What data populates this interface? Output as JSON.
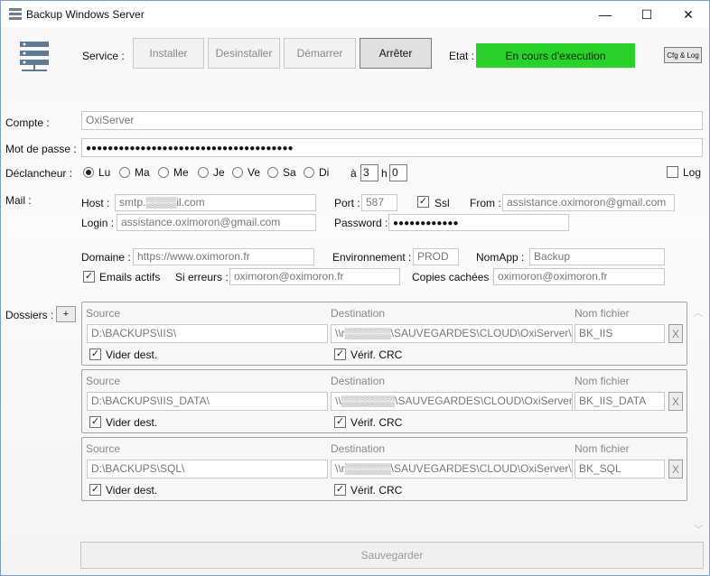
{
  "window": {
    "title": "Backup Windows Server",
    "minimize": "—",
    "maximize": "☐",
    "close": "✕"
  },
  "service": {
    "label": "Service :",
    "install": "Installer",
    "uninstall": "Desinstaller",
    "start": "Démarrer",
    "stop": "Arrêter",
    "state_label": "Etat :",
    "state_value": "En cours d'execution",
    "state_color": "#2ad12a",
    "cfg_log": "Cfg & Log"
  },
  "account": {
    "label": "Compte :",
    "value": "OxiServer"
  },
  "password": {
    "label": "Mot de passe :",
    "value": "●●●●●●●●●●●●●●●●●●●●●●●●●●●●●●●●●●●●●●"
  },
  "trigger": {
    "label": "Déclancheur :",
    "days": [
      "Lu",
      "Ma",
      "Me",
      "Je",
      "Ve",
      "Sa",
      "Di"
    ],
    "selected_day": "Lu",
    "at_label": "à",
    "hour": "3",
    "h_label": "h",
    "minute": "0",
    "log_label": "Log"
  },
  "mail": {
    "label": "Mail :",
    "host_label": "Host :",
    "host_value": "smtp.▒▒▒▒il.com",
    "port_label": "Port :",
    "port_value": "587",
    "ssl_label": "Ssl",
    "from_label": "From :",
    "from_value": "assistance.oximoron@gmail.com",
    "login_label": "Login :",
    "login_value": "assistance.oximoron@gmail.com",
    "password_label": "Password :",
    "password_value": "●●●●●●●●●●●●",
    "domain_label": "Domaine :",
    "domain_value": "https://www.oximoron.fr",
    "env_label": "Environnement :",
    "env_value": "PROD",
    "appname_label": "NomApp :",
    "appname_value": "Backup",
    "emails_active_label": "Emails actifs",
    "if_errors_label": "Si erreurs :",
    "if_errors_value": "oximoron@oximoron.fr",
    "bcc_label": "Copies cachées :",
    "bcc_value": "oximoron@oximoron.fr"
  },
  "folders": {
    "label": "Dossiers :",
    "add": "+",
    "source_label": "Source",
    "dest_label": "Destination",
    "filename_label": "Nom fichier",
    "clear_label": "Vider dest.",
    "crc_label": "Vérif. CRC",
    "remove": "X",
    "items": [
      {
        "source": "D:\\BACKUPS\\IIS\\",
        "destination": "\\\\r▒▒▒▒▒▒\\SAUVEGARDES\\CLOUD\\OxiServer\\IIS",
        "filename": "BK_IIS"
      },
      {
        "source": "D:\\BACKUPS\\IIS_DATA\\",
        "destination": "\\\\▒▒▒▒▒▒▒\\SAUVEGARDES\\CLOUD\\OxiServer\\IIS_D",
        "filename": "BK_IIS_DATA"
      },
      {
        "source": "D:\\BACKUPS\\SQL\\",
        "destination": "\\\\r▒▒▒▒▒▒\\SAUVEGARDES\\CLOUD\\OxiServer\\SQL",
        "filename": "BK_SQL"
      }
    ]
  },
  "save": "Sauvegarder"
}
